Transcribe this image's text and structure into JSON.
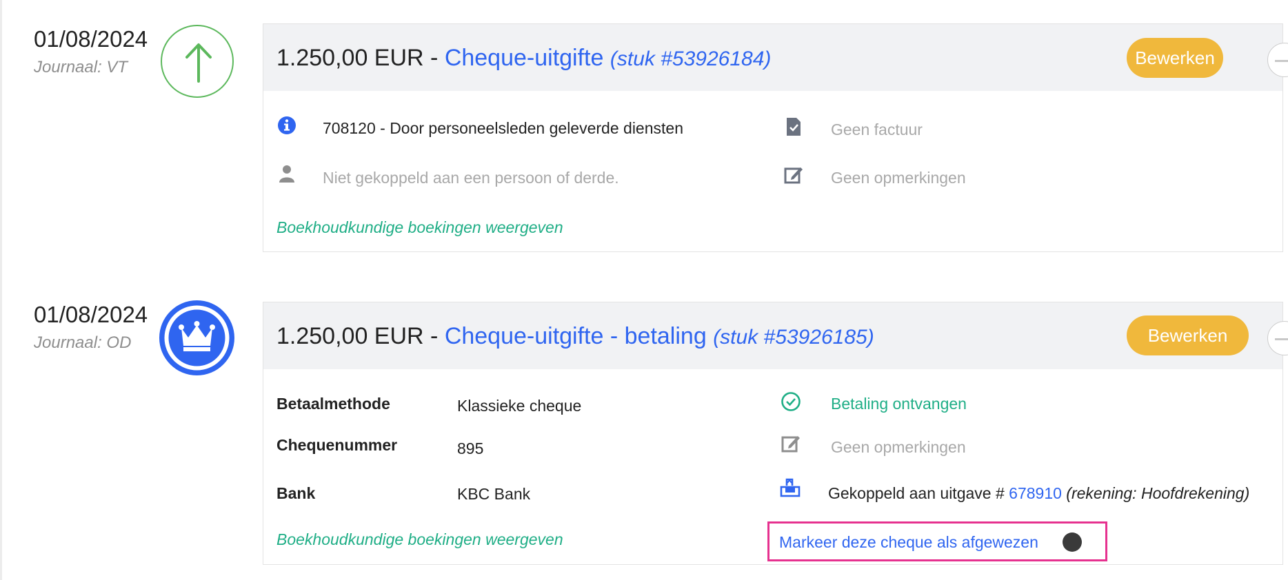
{
  "entries": [
    {
      "date": "01/08/2024",
      "journal": "Journaal: VT",
      "badge_icon": "arrow-up-icon",
      "amount": "1.250,00 EUR",
      "separator": " - ",
      "title": "Cheque-uitgifte",
      "ref": "(stuk #53926184)",
      "edit_label": "Bewerken",
      "account_line": "708120 - Door personeelsleden geleverde diensten",
      "person_line": "Niet gekoppeld aan een persoon of derde.",
      "invoice_line": "Geen factuur",
      "remarks_line": "Geen opmerkingen",
      "bookings_link": "Boekhoudkundige boekingen weergeven"
    },
    {
      "date": "01/08/2024",
      "journal": "Journaal: OD",
      "badge_icon": "crown-icon",
      "amount": "1.250,00 EUR",
      "separator": " - ",
      "title": "Cheque-uitgifte - betaling",
      "ref": "(stuk #53926185)",
      "edit_label": "Bewerken",
      "fields": [
        {
          "label": "Betaalmethode",
          "value": "Klassieke cheque"
        },
        {
          "label": "Chequenummer",
          "value": "895"
        },
        {
          "label": "Bank",
          "value": "KBC Bank"
        }
      ],
      "payment_status": "Betaling ontvangen",
      "remarks_line": "Geen opmerkingen",
      "linked_prefix": "Gekoppeld aan uitgave #",
      "linked_number": "678910",
      "linked_account": "(rekening: Hoofdrekening)",
      "bookings_link": "Boekhoudkundige boekingen weergeven",
      "reject_label": "Markeer deze cheque als afgewezen"
    }
  ],
  "colors": {
    "accent_blue": "#2f65f0",
    "edit_orange": "#f0b83c",
    "success_green": "#1fae86",
    "arrow_green": "#5cb85c",
    "highlight_pink": "#e6318f"
  }
}
